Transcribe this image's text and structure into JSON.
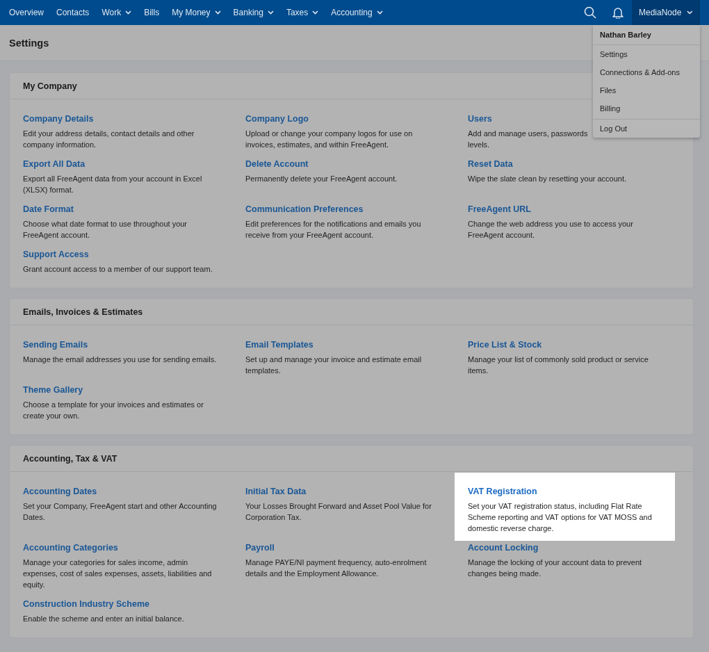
{
  "nav": {
    "items": [
      {
        "label": "Overview",
        "dropdown": false
      },
      {
        "label": "Contacts",
        "dropdown": false
      },
      {
        "label": "Work",
        "dropdown": true
      },
      {
        "label": "Bills",
        "dropdown": false
      },
      {
        "label": "My Money",
        "dropdown": true
      },
      {
        "label": "Banking",
        "dropdown": true
      },
      {
        "label": "Taxes",
        "dropdown": true
      },
      {
        "label": "Accounting",
        "dropdown": true
      }
    ],
    "account": {
      "label": "MediaNode",
      "expanded": true
    }
  },
  "account_menu": {
    "user": "Nathan Barley",
    "items": [
      {
        "label": "Settings",
        "separator_before": false
      },
      {
        "label": "Connections & Add-ons",
        "separator_before": false
      },
      {
        "label": "Files",
        "separator_before": false
      },
      {
        "label": "Billing",
        "separator_before": false
      },
      {
        "label": "Log Out",
        "separator_before": true
      }
    ]
  },
  "page_title": "Settings",
  "sections": [
    {
      "title": "My Company",
      "items": [
        {
          "title": "Company Details",
          "description": "Edit your address details, contact details and other company information.",
          "highlighted": false
        },
        {
          "title": "Company Logo",
          "description": "Upload or change your company logos for use on invoices, estimates, and within FreeAgent.",
          "highlighted": false
        },
        {
          "title": "Users",
          "description": "Add and manage users, passwords\nlevels.",
          "highlighted": false
        },
        {
          "title": "Export All Data",
          "description": "Export all FreeAgent data from your account in Excel (XLSX) format.",
          "highlighted": false
        },
        {
          "title": "Delete Account",
          "description": "Permanently delete your FreeAgent account.",
          "highlighted": false
        },
        {
          "title": "Reset Data",
          "description": "Wipe the slate clean by resetting your account.",
          "highlighted": false
        },
        {
          "title": "Date Format",
          "description": "Choose what date format to use throughout your FreeAgent account.",
          "highlighted": false
        },
        {
          "title": "Communication Preferences",
          "description": "Edit preferences for the notifications and emails you receive from your FreeAgent account.",
          "highlighted": false
        },
        {
          "title": "FreeAgent URL",
          "description": "Change the web address you use to access your FreeAgent account.",
          "highlighted": false
        },
        {
          "title": "Support Access",
          "description": "Grant account access to a member of our support team.",
          "highlighted": false
        }
      ]
    },
    {
      "title": "Emails, Invoices & Estimates",
      "items": [
        {
          "title": "Sending Emails",
          "description": "Manage the email addresses you use for sending emails.",
          "highlighted": false
        },
        {
          "title": "Email Templates",
          "description": "Set up and manage your invoice and estimate email templates.",
          "highlighted": false
        },
        {
          "title": "Price List & Stock",
          "description": "Manage your list of commonly sold product or service items.",
          "highlighted": false
        },
        {
          "title": "Theme Gallery",
          "description": "Choose a template for your invoices and estimates or create your own.",
          "highlighted": false
        }
      ]
    },
    {
      "title": "Accounting, Tax & VAT",
      "items": [
        {
          "title": "Accounting Dates",
          "description": "Set your Company, FreeAgent start and other Accounting Dates.",
          "highlighted": false
        },
        {
          "title": "Initial Tax Data",
          "description": "Your Losses Brought Forward and Asset Pool Value for Corporation Tax.",
          "highlighted": false
        },
        {
          "title": "VAT Registration",
          "description": "Set your VAT registration status, including Flat Rate Scheme reporting and VAT options for VAT MOSS and domestic reverse charge.",
          "highlighted": true
        },
        {
          "title": "Accounting Categories",
          "description": "Manage your categories for sales income, admin expenses, cost of sales expenses, assets, liabilities and equity.",
          "highlighted": false
        },
        {
          "title": "Payroll",
          "description": "Manage PAYE/NI payment frequency, auto-enrolment details and the Employment Allowance.",
          "highlighted": false
        },
        {
          "title": "Account Locking",
          "description": "Manage the locking of your account data to prevent changes being made.",
          "highlighted": false
        },
        {
          "title": "Construction Industry Scheme",
          "description": "Enable the scheme and enter an initial balance.",
          "highlighted": false
        }
      ]
    }
  ]
}
